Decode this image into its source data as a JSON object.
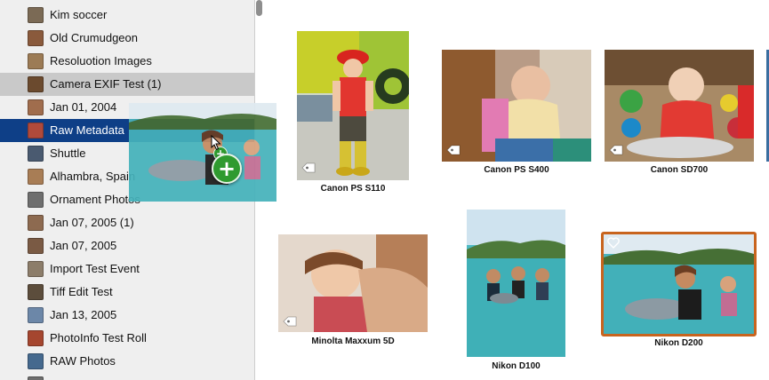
{
  "sidebar": {
    "items": [
      {
        "label": "Kim soccer",
        "thumb": "#7b6a55"
      },
      {
        "label": "Old Crumudgeon",
        "thumb": "#8a5a3c"
      },
      {
        "label": "Resoluotion Images",
        "thumb": "#9c7b55"
      },
      {
        "label": "Camera EXIF Test (1)",
        "thumb": "#6b4a2e",
        "selected": true
      },
      {
        "label": "Jan 01, 2004",
        "thumb": "#a06d4d"
      },
      {
        "label": "Raw Metadata",
        "thumb": "#b04a3b",
        "active": true
      },
      {
        "label": "Shuttle",
        "thumb": "#4a5a70"
      },
      {
        "label": "Alhambra, Spain",
        "thumb": "#a87d55"
      },
      {
        "label": "Ornament Photos",
        "thumb": "#6e6e6e"
      },
      {
        "label": "Jan 07, 2005 (1)",
        "thumb": "#8d6a50"
      },
      {
        "label": "Jan 07, 2005",
        "thumb": "#7a5a44"
      },
      {
        "label": "Import Test Event",
        "thumb": "#8c7d6a"
      },
      {
        "label": "Tiff Edit Test",
        "thumb": "#5c4d3c"
      },
      {
        "label": "Jan 13, 2005",
        "thumb": "#6c87a8"
      },
      {
        "label": "PhotoInfo Test Roll",
        "thumb": "#a5462f"
      },
      {
        "label": "RAW Photos",
        "thumb": "#45698e"
      },
      {
        "label": "",
        "thumb": "#6d6d6d"
      }
    ]
  },
  "photos": [
    {
      "caption": "Canon PS S110",
      "tag": true
    },
    {
      "caption": "Canon PS S400",
      "tag": true
    },
    {
      "caption": "Canon SD700",
      "tag": true
    },
    {
      "caption": "Minolta Maxxum 5D",
      "tag": true
    },
    {
      "caption": "Nikon D100",
      "tag": false
    },
    {
      "caption": "Nikon D200",
      "tag": false,
      "favorite": true,
      "selected": true
    }
  ],
  "colors": {
    "selection_border": "#c8641e",
    "sidebar_active": "#0e3f87",
    "add_badge": "#2f9a2f"
  }
}
